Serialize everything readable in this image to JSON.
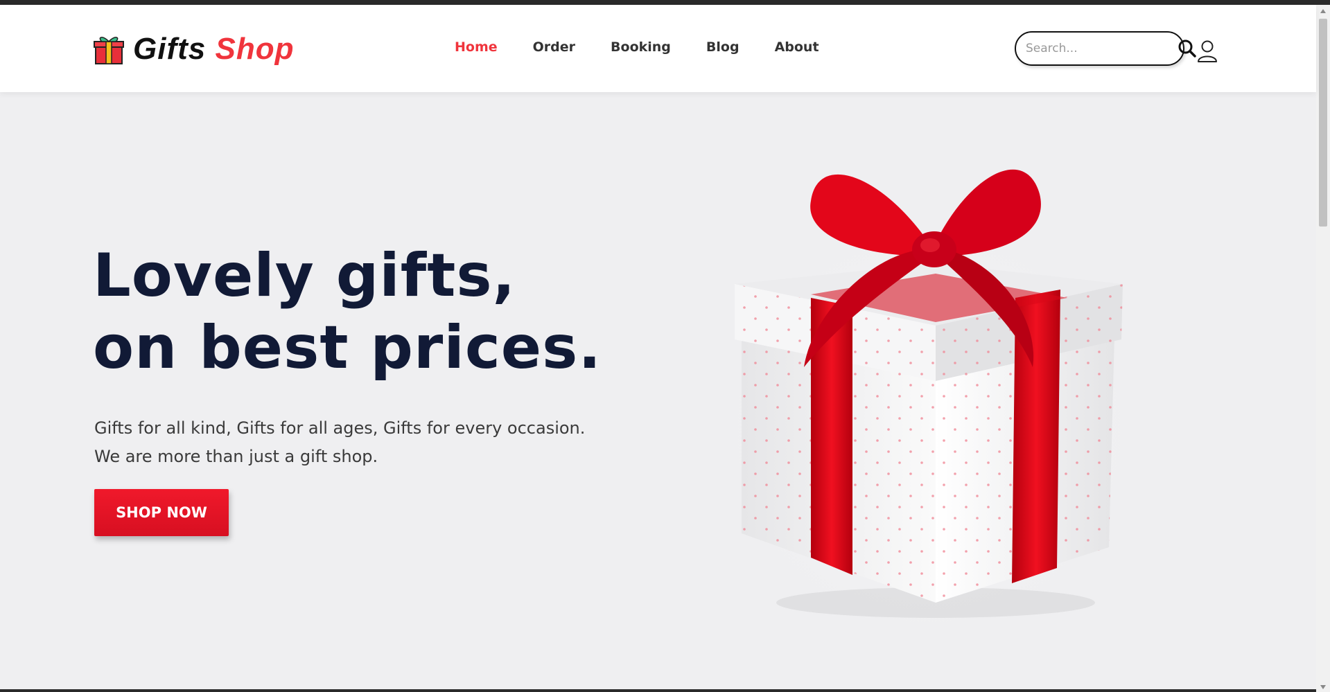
{
  "brand": {
    "name_part1": "Gifts",
    "name_part2": "Shop",
    "accent_color": "#f0343c"
  },
  "nav": {
    "items": [
      {
        "label": "Home",
        "active": true
      },
      {
        "label": "Order",
        "active": false
      },
      {
        "label": "Booking",
        "active": false
      },
      {
        "label": "Blog",
        "active": false
      },
      {
        "label": "About",
        "active": false
      }
    ]
  },
  "search": {
    "placeholder": "Search...",
    "icon": "search-icon"
  },
  "account": {
    "icon": "user-icon"
  },
  "hero": {
    "title_line1": "Lovely gifts,",
    "title_line2": "on best prices.",
    "subtitle_line1": "Gifts for all kind, Gifts for all ages, Gifts for every occasion.",
    "subtitle_line2": "We are more than just a gift shop.",
    "cta_label": "SHOP NOW",
    "cta_color": "#e8142a",
    "title_color": "#111a36"
  },
  "image": {
    "icon": "gift-box-image"
  }
}
